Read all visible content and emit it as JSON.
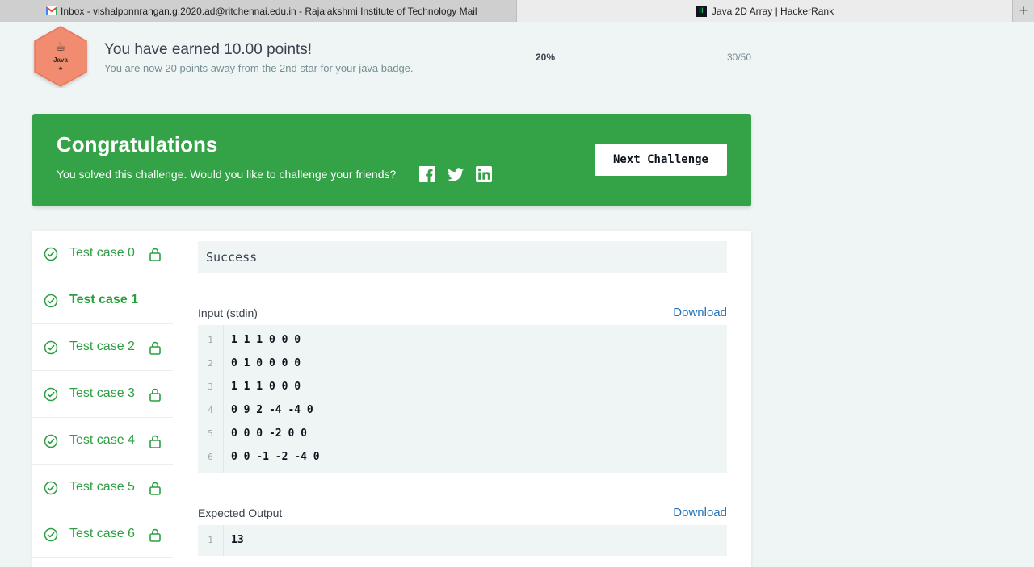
{
  "browser": {
    "tabs": [
      {
        "label": "Inbox - vishalponnrangan.g.2020.ad@ritchennai.edu.in - Rajalakshmi Institute of Technology Mail",
        "icon": "gmail-icon"
      },
      {
        "label": "Java 2D Array | HackerRank",
        "icon": "hackerrank-icon",
        "icon_text": "H"
      }
    ],
    "new_tab": "+"
  },
  "badge": {
    "language": "Java",
    "star": "★",
    "color": "#f28c6f"
  },
  "header": {
    "title": "You have earned 10.00 points!",
    "subtitle": "You are now 20 points away from the 2nd star for your java badge.",
    "percent": "20%",
    "score": "30/50"
  },
  "congrats": {
    "title": "Congratulations",
    "subtitle": "You solved this challenge. Would you like to challenge your friends?",
    "next_button": "Next Challenge",
    "color": "#34a247"
  },
  "test_cases": [
    {
      "label": "Test case 0",
      "locked": true,
      "active": false
    },
    {
      "label": "Test case 1",
      "locked": false,
      "active": true
    },
    {
      "label": "Test case 2",
      "locked": true,
      "active": false
    },
    {
      "label": "Test case 3",
      "locked": true,
      "active": false
    },
    {
      "label": "Test case 4",
      "locked": true,
      "active": false
    },
    {
      "label": "Test case 5",
      "locked": true,
      "active": false
    },
    {
      "label": "Test case 6",
      "locked": true,
      "active": false
    }
  ],
  "result": {
    "status": "Success",
    "input_label": "Input (stdin)",
    "download_label": "Download",
    "input_lines": [
      {
        "n": "1",
        "text": "1 1 1 0 0 0"
      },
      {
        "n": "2",
        "text": "0 1 0 0 0 0"
      },
      {
        "n": "3",
        "text": "1 1 1 0 0 0"
      },
      {
        "n": "4",
        "text": "0 9 2 -4 -4 0"
      },
      {
        "n": "5",
        "text": "0 0 0 -2 0 0"
      },
      {
        "n": "6",
        "text": "0 0 -1 -2 -4 0"
      }
    ],
    "expected_label": "Expected Output",
    "expected_lines": [
      {
        "n": "1",
        "text": "13"
      }
    ]
  }
}
